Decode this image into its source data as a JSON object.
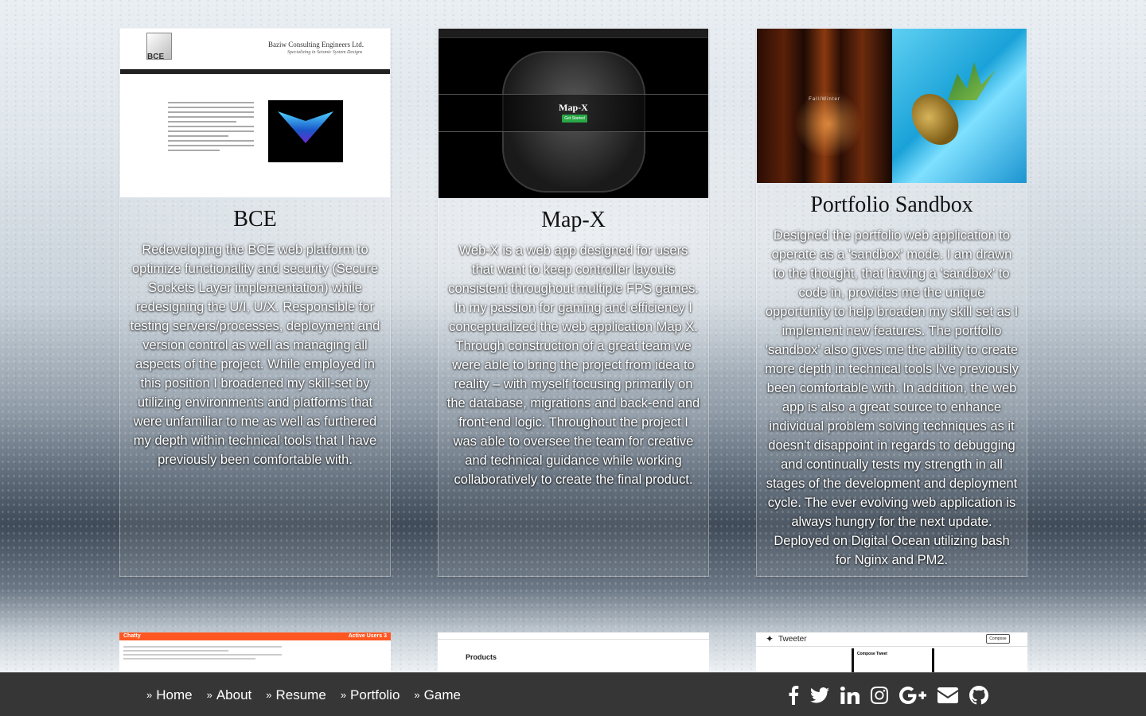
{
  "projects": [
    {
      "title": "BCE",
      "description": "Redeveloping the BCE web platform to optimize functionality and security (Secure Sockets Layer implementation) while redesigning the U/I, U/X. Responsible for testing servers/processes, deployment and version control as well as managing all aspects of the project. While employed in this position I broadened my skill-set by utilizing environments and platforms that were unfamiliar to me as well as furthered my depth within technical tools that I have previously been comfortable with.",
      "thumb": {
        "company": "Baziw Consulting Engineers Ltd.",
        "tagline": "Specializing in Seismic System Designs",
        "logo": "BCE"
      }
    },
    {
      "title": "Map-X",
      "description": "Web-X is a web app designed for users that want to keep controller layouts consistent throughout multiple FPS games. In my passion for gaming and efficiency I conceptualized the web application Map X. Through construction of a great team we were able to bring the project from idea to reality – with myself focusing primarily on the database, migrations and back-end and front-end logic. Throughout the project I was able to oversee the team for creative and technical guidance while working collaboratively to create the final product.",
      "thumb": {
        "brand": "Map-X",
        "cta": "Get Started"
      }
    },
    {
      "title": "Portfolio Sandbox",
      "description": "Designed the portfolio web application to operate as a 'sandbox' mode. I am drawn to the thought, that having a 'sandbox' to code in, provides me the unique opportunity to help broaden my skill set as I implement new features. The portfolio 'sandbox' also gives me the ability to create more depth in technical tools I've previously been comfortable with. In addition, the web app is also a great source to enhance individual problem solving techniques as it doesn't disappoint in regards to debugging and continually tests my strength in all stages of the development and deployment cycle. The ever evolving web application is always hungry for the next update. Deployed on Digital Ocean utilizing bash for Nginx and PM2.",
      "thumb": {
        "overlay": "Fall/Winter"
      }
    }
  ],
  "peek_cards": [
    {
      "app": "Chatty",
      "badge": "Active Users 3"
    },
    {
      "heading": "Products"
    },
    {
      "app": "Tweeter",
      "compose_button": "Compose",
      "compose_heading": "Compose Tweet"
    }
  ],
  "footer": {
    "nav": [
      {
        "label": "Home"
      },
      {
        "label": "About"
      },
      {
        "label": "Resume"
      },
      {
        "label": "Portfolio"
      },
      {
        "label": "Game"
      }
    ],
    "social_icons": [
      "facebook-icon",
      "twitter-icon",
      "linkedin-icon",
      "instagram-icon",
      "google-plus-icon",
      "envelope-icon",
      "github-icon"
    ]
  }
}
